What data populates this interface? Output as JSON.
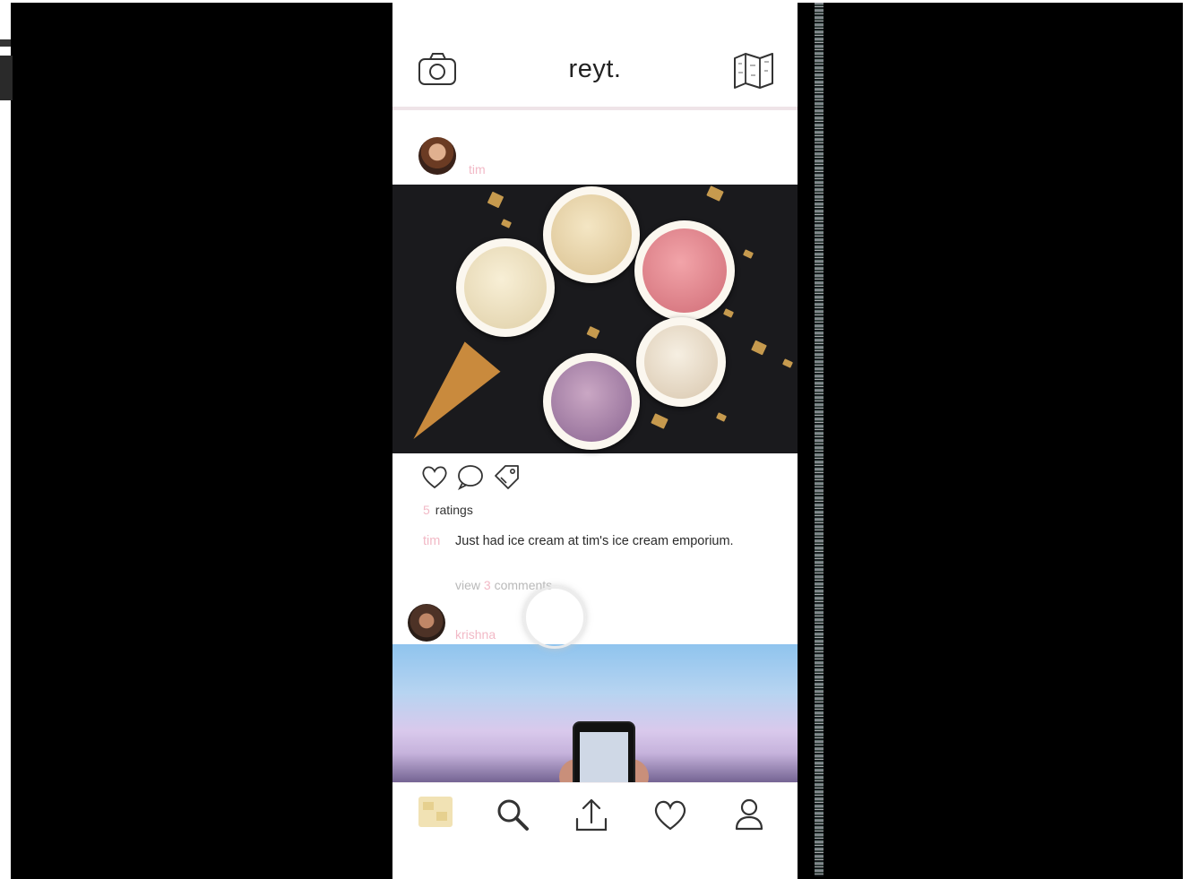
{
  "app": {
    "title": "reyt."
  },
  "header": {
    "left_icon": "camera-icon",
    "right_icon": "map-icon"
  },
  "posts": [
    {
      "username": "tim",
      "image_icon": "ice-cream-photo",
      "ratings_count": "5",
      "ratings_label": "ratings",
      "caption_user": "tim",
      "caption": "Just had ice cream at tim's ice cream emporium.",
      "view_comments": {
        "prefix": "view",
        "count": "3",
        "suffix": "comments"
      }
    },
    {
      "username": "krishna",
      "image_icon": "sky-phone-photo"
    }
  ],
  "actions": [
    "heart-icon",
    "comment-icon",
    "tag-icon"
  ],
  "tabbar": [
    "home-icon",
    "search-icon",
    "upload-icon",
    "heart-icon",
    "profile-icon"
  ],
  "colors": {
    "accent_pink": "#f2b9c6",
    "divider": "#efe4e8",
    "home_active": "#f1e2b4"
  }
}
